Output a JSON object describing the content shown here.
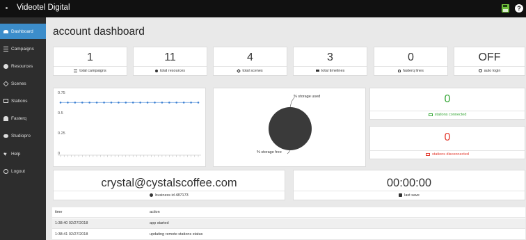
{
  "app": {
    "title": "Videotel Digital"
  },
  "sidebar": {
    "items": [
      {
        "label": "Dashboard",
        "icon": "dashboard-icon",
        "active": true
      },
      {
        "label": "Campaigns",
        "icon": "list-icon"
      },
      {
        "label": "Resources",
        "icon": "circle-icon"
      },
      {
        "label": "Scenes",
        "icon": "diamond-icon"
      },
      {
        "label": "Stations",
        "icon": "monitor-icon"
      },
      {
        "label": "Fasterq",
        "icon": "people-icon"
      },
      {
        "label": "Studiopro",
        "icon": "cloud-icon"
      },
      {
        "label": "Help",
        "icon": "heart-icon"
      },
      {
        "label": "Logout",
        "icon": "power-icon"
      }
    ]
  },
  "page": {
    "title": "account dashboard"
  },
  "stats": [
    {
      "value": "1",
      "label": "total campaigns",
      "icon": "list-icon"
    },
    {
      "value": "11",
      "label": "total resources",
      "icon": "dot-icon"
    },
    {
      "value": "4",
      "label": "total scenes",
      "icon": "diamond-icon"
    },
    {
      "value": "3",
      "label": "total timelines",
      "icon": "lines-icon"
    },
    {
      "value": "0",
      "label": "fasterq lines",
      "icon": "person-icon"
    },
    {
      "value": "OFF",
      "label": "auto login",
      "icon": "circle-icon"
    }
  ],
  "chart_data": {
    "type": "line",
    "title": "",
    "xlabel": "",
    "ylabel": "",
    "ylim": [
      0,
      0.75
    ],
    "y_ticks": [
      "0.75",
      "0.5",
      "0.25",
      "0"
    ],
    "series": [
      {
        "values": [
          0.6,
          0.6,
          0.6,
          0.6,
          0.6,
          0.6,
          0.6,
          0.6,
          0.6,
          0.6,
          0.6,
          0.6,
          0.6,
          0.6,
          0.6,
          0.6,
          0.6,
          0.6,
          0.6,
          0.6
        ]
      }
    ],
    "grid": false,
    "colors": {
      "line": "#8fb8e8",
      "point": "#3c7fd0"
    }
  },
  "storage": {
    "used_label": "% storage used",
    "free_label": "% storage free",
    "used_fraction": 0.0,
    "colors": {
      "free": "#3a3a3a"
    }
  },
  "stations": {
    "connected": {
      "value": "0",
      "label": "stations connected"
    },
    "disconnected": {
      "value": "0",
      "label": "stations disconnected"
    }
  },
  "account": {
    "email": "crystal@cystalscoffee.com",
    "business_label": "business id 487173"
  },
  "session": {
    "timer": "00:00:00",
    "save_label": "last save"
  },
  "log": {
    "headers": {
      "time": "time",
      "action": "action"
    },
    "rows": [
      {
        "time": "1:38:40 02/27/2018",
        "action": "app started"
      },
      {
        "time": "1:38:41 02/27/2018",
        "action": "updating remote stations status"
      }
    ]
  },
  "colors": {
    "accent": "#3c8dca",
    "green": "#39a83a",
    "red": "#e33b2f",
    "topbar": "#111111",
    "sidebar": "#2d2d2d"
  }
}
